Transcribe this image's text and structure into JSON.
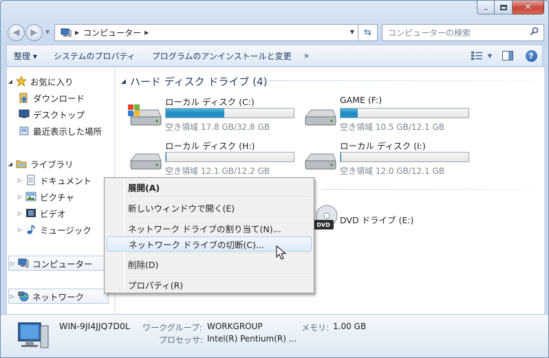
{
  "window": {
    "caption_buttons": [
      "minimize-icon",
      "maximize-icon",
      "close-icon"
    ]
  },
  "address_bar": {
    "crumb": "コンピューター",
    "search_placeholder": "コンピューターの検索"
  },
  "toolbar": {
    "organize": "整理 ▾",
    "system_properties": "システムのプロパティ",
    "uninstall": "プログラムのアンインストールと変更",
    "more": "»"
  },
  "nav_pane": {
    "favorites": "お気に入り",
    "downloads": "ダウンロード",
    "desktop": "デスクトップ",
    "recent": "最近表示した場所",
    "libraries": "ライブラリ",
    "documents": "ドキュメント",
    "pictures": "ピクチャ",
    "videos": "ビデオ",
    "music": "ミュージック",
    "computer": "コンピューター",
    "network": "ネットワーク"
  },
  "main": {
    "group_hdd": "ハード ディスク ドライブ (4)",
    "drives": [
      {
        "name": "ローカル ディスク (C:)",
        "free": "空き領域 17.8 GB/32.8 GB",
        "used_fraction": 0.457
      },
      {
        "name": "GAME (F:)",
        "free": "空き領域 10.5 GB/12.1 GB",
        "used_fraction": 0.132
      },
      {
        "name": "ローカル ディスク (H:)",
        "free": "空き領域 12.1 GB/12.2 GB",
        "used_fraction": 0.008
      },
      {
        "name": "ローカル ディスク (I:)",
        "free": "空き領域 12.0 GB/12.1 GB",
        "used_fraction": 0.008
      }
    ],
    "dvd": "DVD ドライブ (E:)",
    "dvd_badge": "DVD"
  },
  "details": {
    "computer_name": "WIN-9JI4JJQ7D0L",
    "workgroup_label": "ワークグループ:",
    "workgroup_value": "WORKGROUP",
    "memory_label": "メモリ:",
    "memory_value": "1.00 GB",
    "processor_label": "プロセッサ:",
    "processor_value": "Intel(R) Pentium(R) ..."
  },
  "context_menu": {
    "expand": "展開(A)",
    "open_new_window": "新しいウィンドウで開く(E)",
    "map_drive": "ネットワーク ドライブの割り当て(N)...",
    "disconnect_drive": "ネットワーク ドライブの切断(C)...",
    "delete": "削除(D)",
    "properties": "プロパティ(R)"
  }
}
